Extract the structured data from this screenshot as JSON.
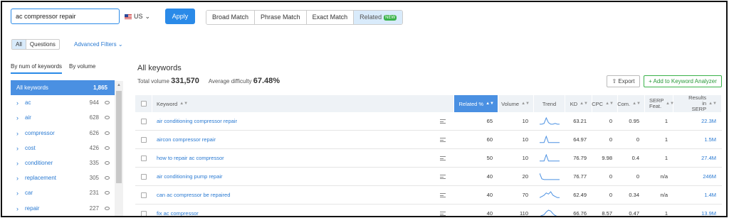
{
  "search": {
    "query": "ac compressor repair",
    "country": "US",
    "apply_label": "Apply"
  },
  "match_tabs": [
    "Broad Match",
    "Phrase Match",
    "Exact Match",
    "Related"
  ],
  "new_badge": "NEW",
  "filters": {
    "all_label": "All",
    "questions_label": "Questions",
    "advanced_label": "Advanced Filters"
  },
  "left_tabs": [
    "By num of keywords",
    "By volume"
  ],
  "groups": [
    {
      "label": "All keywords",
      "count": "1,865"
    },
    {
      "label": "ac",
      "count": "944"
    },
    {
      "label": "air",
      "count": "628"
    },
    {
      "label": "compressor",
      "count": "626"
    },
    {
      "label": "cost",
      "count": "426"
    },
    {
      "label": "conditioner",
      "count": "335"
    },
    {
      "label": "replacement",
      "count": "305"
    },
    {
      "label": "car",
      "count": "231"
    },
    {
      "label": "repair",
      "count": "227"
    }
  ],
  "main": {
    "title": "All keywords",
    "total_volume_label": "Total volume",
    "total_volume": "331,570",
    "avg_difficulty_label": "Average difficulty",
    "avg_difficulty": "67.48%",
    "export_label": "Export",
    "add_label": "Add to Keyword Analyzer"
  },
  "columns": [
    "Keyword",
    "Related %",
    "Volume",
    "Trend",
    "KD",
    "CPC",
    "Com.",
    "SERP Feat.",
    "Results in SERP"
  ],
  "rows": [
    {
      "keyword": "air conditioning compressor repair",
      "related": "65",
      "volume": "10",
      "trend": [
        1,
        1,
        2,
        9,
        3,
        1,
        1,
        2,
        1,
        1
      ],
      "kd": "63.21",
      "cpc": "0",
      "com": "0.95",
      "serp": "1",
      "results": "22.3M"
    },
    {
      "keyword": "aircon compressor repair",
      "related": "60",
      "volume": "10",
      "trend": [
        1,
        1,
        1,
        8,
        1,
        1,
        1,
        1,
        1,
        1
      ],
      "kd": "64.97",
      "cpc": "0",
      "com": "0",
      "serp": "1",
      "results": "1.5M"
    },
    {
      "keyword": "how to repair ac compressor",
      "related": "50",
      "volume": "10",
      "trend": [
        1,
        1,
        1,
        8,
        1,
        1,
        1,
        1,
        1,
        1
      ],
      "kd": "76.79",
      "cpc": "9.98",
      "com": "0.4",
      "serp": "1",
      "results": "27.4M"
    },
    {
      "keyword": "air conditioning pump repair",
      "related": "40",
      "volume": "20",
      "trend": [
        9,
        2,
        1,
        1,
        1,
        1,
        1,
        1,
        1,
        1
      ],
      "kd": "76.77",
      "cpc": "0",
      "com": "0",
      "serp": "n/a",
      "results": "246M"
    },
    {
      "keyword": "can ac compressor be repaired",
      "related": "40",
      "volume": "70",
      "trend": [
        1,
        2,
        3,
        5,
        4,
        6,
        3,
        2,
        1,
        1
      ],
      "kd": "62.49",
      "cpc": "0",
      "com": "0.34",
      "serp": "n/a",
      "results": "1.4M"
    },
    {
      "keyword": "fix ac compressor",
      "related": "40",
      "volume": "110",
      "trend": [
        1,
        2,
        3,
        6,
        8,
        7,
        4,
        2,
        1,
        1
      ],
      "kd": "66.76",
      "cpc": "8.57",
      "com": "0.47",
      "serp": "1",
      "results": "13.9M"
    }
  ]
}
